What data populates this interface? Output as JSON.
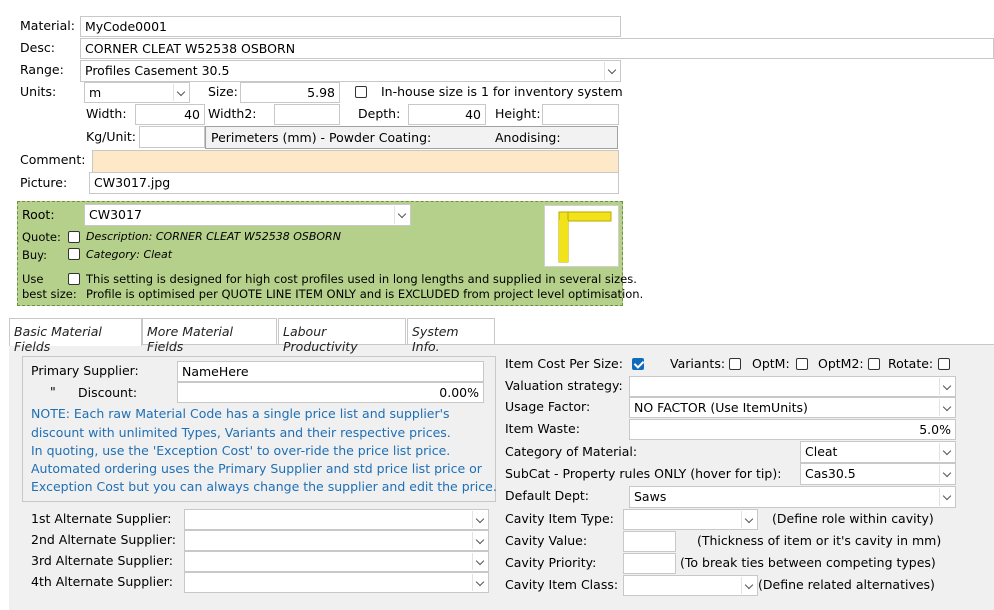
{
  "top": {
    "material_label": "Material:",
    "material_value": "MyCode0001",
    "desc_label": "Desc:",
    "desc_value": "CORNER CLEAT W52538 OSBORN",
    "range_label": "Range:",
    "range_value": "Profiles Casement 30.5",
    "units_label": "Units:",
    "units_value": "m",
    "size_label": "Size:",
    "size_value": "5.98",
    "inhouse_label": "In-house size is 1 for inventory system",
    "width_label": "Width:",
    "width_value": "40",
    "width2_label": "Width2:",
    "width2_value": "",
    "depth_label": "Depth:",
    "depth_value": "40",
    "height_label": "Height:",
    "height_value": "",
    "kgunit_label": "Kg/Unit:",
    "kgunit_value": "",
    "perimeters_label": "Perimeters (mm) - Powder Coating:",
    "anodising_label": "Anodising:",
    "comment_label": "Comment:",
    "comment_value": "",
    "picture_label": "Picture:",
    "picture_value": "CW3017.jpg"
  },
  "root_panel": {
    "root_label": "Root:",
    "root_value": "CW3017",
    "quote_label": "Quote:",
    "description_text": "Description: CORNER CLEAT W52538 OSBORN",
    "buy_label": "Buy:",
    "category_text": "Category: Cleat",
    "use_label": "Use",
    "best_size_label": "best size:",
    "best_size_line1": "This setting is designed for high cost profiles used in long lengths and supplied in several sizes.",
    "best_size_line2": "Profile is optimised per QUOTE LINE ITEM ONLY and is EXCLUDED from project level optimisation.",
    "thumb_color": "#f2e21a"
  },
  "tabs": [
    {
      "label": "Basic Material Fields",
      "active": true
    },
    {
      "label": "More Material Fields",
      "active": false
    },
    {
      "label": "Labour Productivity",
      "active": false
    },
    {
      "label": "System Info.",
      "active": false
    }
  ],
  "left": {
    "primary_supplier_label": "Primary Supplier:",
    "primary_supplier_value": "NameHere",
    "ditto": "\"",
    "discount_label": "Discount:",
    "discount_value": "0.00%",
    "note_lines": [
      "NOTE: Each raw Material Code has a single price list and supplier's",
      "discount with unlimited Types, Variants and their respective prices.",
      "In quoting, use the 'Exception Cost' to over-ride the price list price.",
      "Automated ordering uses the Primary Supplier and std price list price or",
      "Exception Cost but you can always change the supplier and edit the price."
    ],
    "alt1_label": "1st  Alternate Supplier:",
    "alt2_label": "2nd Alternate Supplier:",
    "alt3_label": "3rd  Alternate Supplier:",
    "alt4_label": "4th  Alternate Supplier:"
  },
  "right": {
    "item_cost_label": "Item Cost Per Size:",
    "item_cost_checked": true,
    "variants_label": "Variants:",
    "optm_label": "OptM:",
    "optm2_label": "OptM2:",
    "rotate_label": "Rotate:",
    "valuation_label": "Valuation strategy:",
    "valuation_value": "",
    "usage_label": "Usage Factor:",
    "usage_value": "NO FACTOR (Use ItemUnits)",
    "waste_label": "Item Waste:",
    "waste_value": "5.0%",
    "category_label": "Category of Material:",
    "category_value": "Cleat",
    "subcat_label": "SubCat - Property rules ONLY (hover for tip):",
    "subcat_value": "Cas30.5",
    "dept_label": "Default Dept:",
    "dept_value": "Saws",
    "cavity_type_label": "Cavity Item Type:",
    "cavity_type_hint": "(Define role within cavity)",
    "cavity_value_label": "Cavity Value:",
    "cavity_value_hint": "(Thickness of item or it's cavity in mm)",
    "cavity_priority_label": "Cavity Priority:",
    "cavity_priority_hint": "(To break ties between competing types)",
    "cavity_class_label": "Cavity Item Class:",
    "cavity_class_hint": "(Define related alternatives)"
  }
}
